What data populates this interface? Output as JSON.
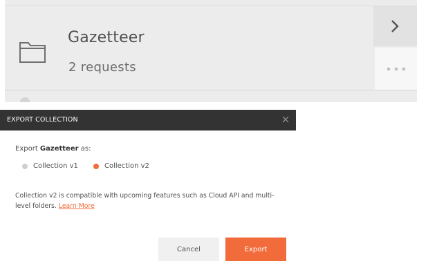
{
  "collection_card": {
    "name": "Gazetteer",
    "request_count": "2 requests",
    "folder_icon": "folder-icon",
    "expand_icon": "chevron-right-icon",
    "more_icon": "ellipsis-icon"
  },
  "export_modal": {
    "title": "EXPORT COLLECTION",
    "close_icon": "close-icon",
    "prompt_prefix": "Export ",
    "collection_name": "Gazetteer",
    "prompt_suffix": " as:",
    "options": [
      {
        "label": "Collection v1",
        "selected": false
      },
      {
        "label": "Collection v2",
        "selected": true
      }
    ],
    "info_text": "Collection v2 is compatible with upcoming features such as Cloud API and multi-level folders. ",
    "learn_more_link": "Learn More",
    "cancel_label": "Cancel",
    "export_label": "Export"
  },
  "colors": {
    "accent": "#f26b3a",
    "header_bg": "#333333",
    "card_bg": "#ececec"
  }
}
